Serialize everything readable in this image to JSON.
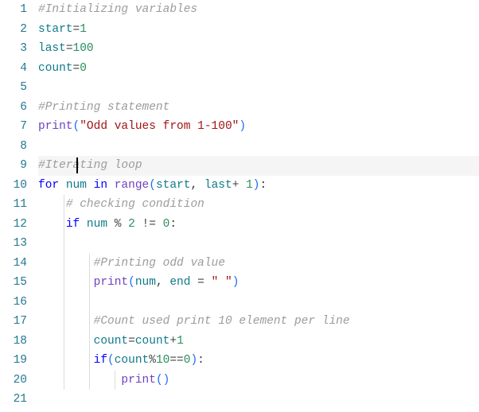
{
  "lineCount": 21,
  "activeLine": 9,
  "caretColumn": 6,
  "indentWidth": 4,
  "charWidth": 8,
  "code": {
    "l1": {
      "indent": 0,
      "guides": [],
      "tokens": [
        {
          "c": "comment",
          "t": "#Initializing variables"
        }
      ]
    },
    "l2": {
      "indent": 0,
      "guides": [],
      "tokens": [
        {
          "c": "ident",
          "t": "start"
        },
        {
          "c": "op",
          "t": "="
        },
        {
          "c": "num",
          "t": "1"
        }
      ]
    },
    "l3": {
      "indent": 0,
      "guides": [],
      "tokens": [
        {
          "c": "ident",
          "t": "last"
        },
        {
          "c": "op",
          "t": "="
        },
        {
          "c": "num",
          "t": "100"
        }
      ]
    },
    "l4": {
      "indent": 0,
      "guides": [],
      "tokens": [
        {
          "c": "ident",
          "t": "count"
        },
        {
          "c": "op",
          "t": "="
        },
        {
          "c": "num",
          "t": "0"
        }
      ]
    },
    "l5": {
      "indent": 0,
      "guides": [],
      "tokens": []
    },
    "l6": {
      "indent": 0,
      "guides": [],
      "tokens": [
        {
          "c": "comment",
          "t": "#Printing statement"
        }
      ]
    },
    "l7": {
      "indent": 0,
      "guides": [],
      "tokens": [
        {
          "c": "func",
          "t": "print"
        },
        {
          "c": "paren",
          "t": "("
        },
        {
          "c": "string",
          "t": "\"Odd values from 1-100\""
        },
        {
          "c": "paren",
          "t": ")"
        }
      ]
    },
    "l8": {
      "indent": 0,
      "guides": [],
      "tokens": []
    },
    "l9": {
      "indent": 0,
      "guides": [],
      "tokens": [
        {
          "c": "comment",
          "t": "#Iterating loop"
        }
      ]
    },
    "l10": {
      "indent": 0,
      "guides": [],
      "tokens": [
        {
          "c": "kw",
          "t": "for"
        },
        {
          "c": "space",
          "t": " "
        },
        {
          "c": "ident",
          "t": "num"
        },
        {
          "c": "space",
          "t": " "
        },
        {
          "c": "kw",
          "t": "in"
        },
        {
          "c": "space",
          "t": " "
        },
        {
          "c": "func",
          "t": "range"
        },
        {
          "c": "paren",
          "t": "("
        },
        {
          "c": "ident",
          "t": "start"
        },
        {
          "c": "plain",
          "t": ", "
        },
        {
          "c": "ident",
          "t": "last"
        },
        {
          "c": "op",
          "t": "+"
        },
        {
          "c": "space",
          "t": " "
        },
        {
          "c": "num",
          "t": "1"
        },
        {
          "c": "paren",
          "t": ")"
        },
        {
          "c": "plain",
          "t": ":"
        }
      ]
    },
    "l11": {
      "indent": 1,
      "guides": [
        1
      ],
      "tokens": [
        {
          "c": "comment",
          "t": "# checking condition"
        }
      ]
    },
    "l12": {
      "indent": 1,
      "guides": [
        1
      ],
      "tokens": [
        {
          "c": "kw",
          "t": "if"
        },
        {
          "c": "space",
          "t": " "
        },
        {
          "c": "ident",
          "t": "num"
        },
        {
          "c": "space",
          "t": " "
        },
        {
          "c": "op",
          "t": "%"
        },
        {
          "c": "space",
          "t": " "
        },
        {
          "c": "num",
          "t": "2"
        },
        {
          "c": "space",
          "t": " "
        },
        {
          "c": "op",
          "t": "!="
        },
        {
          "c": "space",
          "t": " "
        },
        {
          "c": "num",
          "t": "0"
        },
        {
          "c": "plain",
          "t": ":"
        }
      ]
    },
    "l13": {
      "indent": 1,
      "guides": [
        1
      ],
      "tokens": []
    },
    "l14": {
      "indent": 2,
      "guides": [
        1,
        2
      ],
      "tokens": [
        {
          "c": "comment",
          "t": "#Printing odd value"
        }
      ]
    },
    "l15": {
      "indent": 2,
      "guides": [
        1,
        2
      ],
      "tokens": [
        {
          "c": "func",
          "t": "print"
        },
        {
          "c": "paren",
          "t": "("
        },
        {
          "c": "ident",
          "t": "num"
        },
        {
          "c": "plain",
          "t": ", "
        },
        {
          "c": "ident",
          "t": "end"
        },
        {
          "c": "space",
          "t": " "
        },
        {
          "c": "op",
          "t": "="
        },
        {
          "c": "space",
          "t": " "
        },
        {
          "c": "string",
          "t": "\" \""
        },
        {
          "c": "paren",
          "t": ")"
        }
      ]
    },
    "l16": {
      "indent": 2,
      "guides": [
        1,
        2
      ],
      "tokens": []
    },
    "l17": {
      "indent": 2,
      "guides": [
        1,
        2
      ],
      "tokens": [
        {
          "c": "comment",
          "t": "#Count used print 10 element per line"
        }
      ]
    },
    "l18": {
      "indent": 2,
      "guides": [
        1,
        2
      ],
      "tokens": [
        {
          "c": "ident",
          "t": "count"
        },
        {
          "c": "op",
          "t": "="
        },
        {
          "c": "ident",
          "t": "count"
        },
        {
          "c": "op",
          "t": "+"
        },
        {
          "c": "num",
          "t": "1"
        }
      ]
    },
    "l19": {
      "indent": 2,
      "guides": [
        1,
        2
      ],
      "tokens": [
        {
          "c": "kw",
          "t": "if"
        },
        {
          "c": "paren",
          "t": "("
        },
        {
          "c": "ident",
          "t": "count"
        },
        {
          "c": "op",
          "t": "%"
        },
        {
          "c": "num",
          "t": "10"
        },
        {
          "c": "op",
          "t": "=="
        },
        {
          "c": "num",
          "t": "0"
        },
        {
          "c": "paren",
          "t": ")"
        },
        {
          "c": "plain",
          "t": ":"
        }
      ]
    },
    "l20": {
      "indent": 3,
      "guides": [
        1,
        2,
        3
      ],
      "tokens": [
        {
          "c": "func",
          "t": "print"
        },
        {
          "c": "paren",
          "t": "()"
        }
      ]
    },
    "l21": {
      "indent": 0,
      "guides": [],
      "tokens": []
    }
  }
}
